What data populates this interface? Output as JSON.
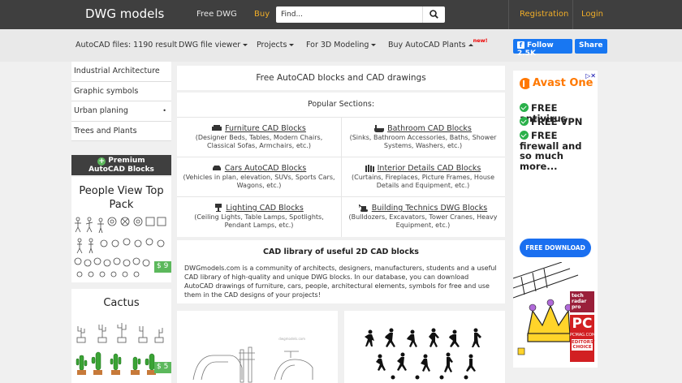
{
  "header": {
    "brand": "DWG models",
    "nav_free": "Free DWG",
    "nav_buy": "Buy",
    "search_placeholder": "Find...",
    "registration": "Registration",
    "login": "Login"
  },
  "subnav": {
    "files_count": "AutoCAD files: 1190 result",
    "viewer": "DWG file viewer",
    "projects": "Projects",
    "for_3d": "For 3D Modeling",
    "buy_plants": "Buy AutoCAD Plants",
    "new_badge": "new!",
    "fb_follow": "Follow 2.5K",
    "fb_share": "Share"
  },
  "sidebar": {
    "items": [
      {
        "label": "Industrial Architecture"
      },
      {
        "label": "Graphic symbols"
      },
      {
        "label": "Urban planing"
      },
      {
        "label": "Trees and Plants"
      }
    ],
    "premium_line1": "Premium",
    "premium_line2": "AutoCAD Blocks",
    "promos": [
      {
        "title": "People View Top Pack",
        "price": "$ 9"
      },
      {
        "title": "Cactus",
        "price": "$ 5"
      }
    ]
  },
  "main": {
    "title": "Free AutoCAD blocks and CAD drawings",
    "popular_header": "Popular Sections:",
    "sections": [
      {
        "label": "Furniture CAD Blocks",
        "desc": "(Designer Beds, Tables, Modern Chairs, Classical Sofas, Armchairs, etc.)",
        "icon": "sofa-icon"
      },
      {
        "label": "Bathroom CAD Blocks",
        "desc": "(Sinks, Bathroom Accessories, Baths, Shower Systems, Washers, etc.)",
        "icon": "bathtub-icon"
      },
      {
        "label": "Cars AutoCAD Blocks",
        "desc": "(Vehicles in plan, elevation, SUVs, Sports Cars, Wagons, etc.)",
        "icon": "car-icon"
      },
      {
        "label": "Interior Details CAD Blocks",
        "desc": "(Curtains, Fireplaces, Picture Frames, House Details and Equipment, etc.)",
        "icon": "books-icon"
      },
      {
        "label": "Lighting CAD Blocks",
        "desc": "(Ceiling Lights, Table Lamps, Spotlights, Pendant Lamps, etc.)",
        "icon": "lamp-icon"
      },
      {
        "label": "Building Technics DWG Blocks",
        "desc": "(Bulldozers, Excavators, Tower Cranes, Heavy Equipment, etc.)",
        "icon": "excavator-icon"
      }
    ],
    "about_title": "CAD library of useful 2D CAD blocks",
    "about_text": "DWGmodels.com is a community of architects, designers, manufacturers, students and a useful CAD library of high-quality and unique DWG blocks. In our database, you can download AutoCAD drawings of furniture, cars, people, architectural elements, symbols for free and use them in the CAD designs of your projects!",
    "thumb_watermark": "dwgmodels.com"
  },
  "ad": {
    "brand": "Avast One",
    "features": [
      "FREE antivirus",
      "FREE VPN",
      "FREE firewall and so much more..."
    ],
    "button": "FREE DOWNLOAD",
    "badge1_line1": "tech",
    "badge1_line2": "radar",
    "badge1_line3": "pro",
    "pcmag_big": "PC",
    "pcmag_small": "PCMAG.COM",
    "pcmag_choice": "EDITORS' CHOICE",
    "close": "▷✕"
  },
  "colors": {
    "navbar": "#3f3f3f",
    "accent": "#f0ad28",
    "facebook": "#1877f2",
    "price_green": "#5cb85c",
    "avast_orange": "#ff7800"
  }
}
